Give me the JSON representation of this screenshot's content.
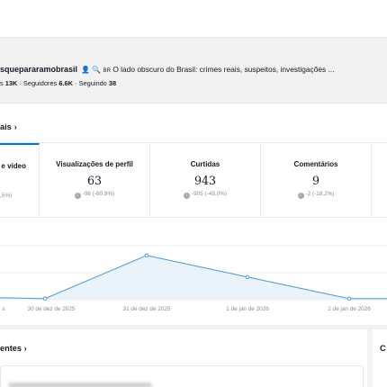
{
  "profile": {
    "username": "squepararamobrasil",
    "flag": "BR",
    "bio": "O lado obscuro do Brasil: crimes reais, suspeitos, investigações ...",
    "likes_label": "s",
    "likes_value": "13K",
    "followers_label": "Seguidores",
    "followers_value": "6.6K",
    "following_label": "Seguindo",
    "following_value": "38"
  },
  "overview": {
    "title": "ais",
    "chevron": "›"
  },
  "metrics": [
    {
      "label": "e vídeo",
      "value": "",
      "delta": ",5%)"
    },
    {
      "label": "Visualizações de perfil",
      "value": "63",
      "delta": "-98 (-60,9%)"
    },
    {
      "label": "Curtidas",
      "value": "943",
      "delta": "-905 (-49,0%)"
    },
    {
      "label": "Comentários",
      "value": "9",
      "delta": "-2 (-18,2%)"
    }
  ],
  "chart_data": {
    "type": "area",
    "x": [
      "",
      "30 de dez de 2025",
      "31 de dez de 2025",
      "",
      "1 de jan de 2026",
      "2 de jan de 2026",
      ""
    ],
    "tick_labels": [
      "s",
      "30 de dez de 2025",
      "31 de dez de 2025",
      "1 de jan de 2026",
      "2 de jan de 2026"
    ],
    "series": [
      {
        "values": [
          2,
          1,
          41,
          21,
          1,
          1,
          1
        ],
        "color": "#5aa0d2"
      }
    ],
    "ylim": [
      0,
      50
    ],
    "grid": true,
    "fill": "#eaf3fa"
  },
  "latest": {
    "title": "entes",
    "chevron": "›"
  },
  "right_panel": {
    "title": "C"
  }
}
